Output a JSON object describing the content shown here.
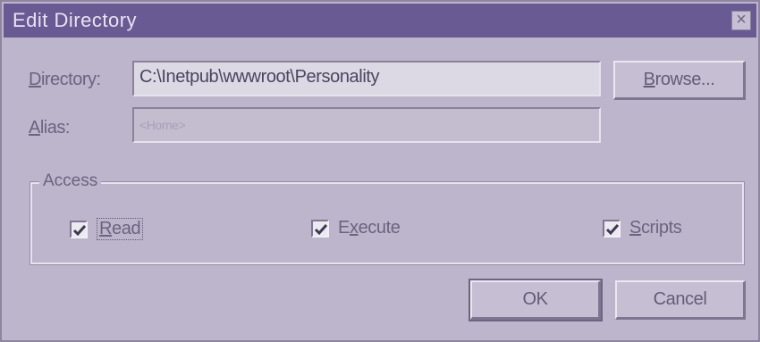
{
  "window": {
    "title": "Edit Directory",
    "close_glyph": "×"
  },
  "directory": {
    "label_first": "D",
    "label_rest": "irectory:",
    "value": "C:\\Inetpub\\wwwroot\\Personality"
  },
  "alias": {
    "label_first": "A",
    "label_rest": "lias:",
    "value": "<Home>"
  },
  "buttons": {
    "browse_first": "B",
    "browse_rest": "rowse...",
    "ok": "OK",
    "cancel": "Cancel"
  },
  "access": {
    "title": "Access",
    "read": {
      "first": "R",
      "rest": "ead",
      "checked": true
    },
    "execute": {
      "pre": "E",
      "ul": "x",
      "rest": "ecute",
      "checked": true
    },
    "scripts": {
      "first": "S",
      "rest": "cripts",
      "checked": true
    }
  }
}
